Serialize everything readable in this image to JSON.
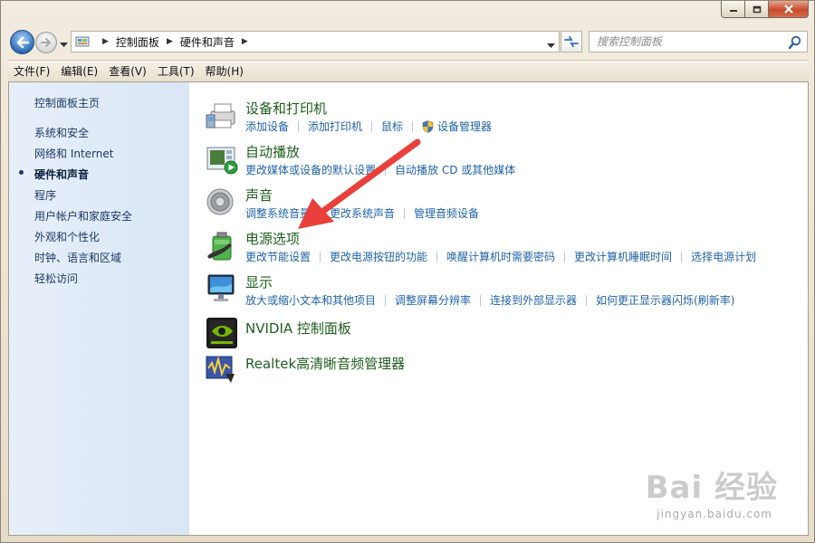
{
  "address": {
    "crumbs": [
      "控制面板",
      "硬件和声音"
    ]
  },
  "search": {
    "placeholder": "搜索控制面板"
  },
  "menu": [
    "文件(F)",
    "编辑(E)",
    "查看(V)",
    "工具(T)",
    "帮助(H)"
  ],
  "sidebar": {
    "home": "控制面板主页",
    "items": [
      {
        "label": "系统和安全",
        "current": false
      },
      {
        "label": "网络和 Internet",
        "current": false
      },
      {
        "label": "硬件和声音",
        "current": true
      },
      {
        "label": "程序",
        "current": false
      },
      {
        "label": "用户帐户和家庭安全",
        "current": false
      },
      {
        "label": "外观和个性化",
        "current": false
      },
      {
        "label": "时钟、语言和区域",
        "current": false
      },
      {
        "label": "轻松访问",
        "current": false
      }
    ]
  },
  "categories": [
    {
      "title": "设备和打印机",
      "icon": "printer-icon",
      "links": [
        "添加设备",
        "添加打印机",
        "鼠标",
        "设备管理器"
      ]
    },
    {
      "title": "自动播放",
      "icon": "autoplay-icon",
      "links": [
        "更改媒体或设备的默认设置",
        "自动播放 CD 或其他媒体"
      ]
    },
    {
      "title": "声音",
      "icon": "speaker-icon",
      "links": [
        "调整系统音量",
        "更改系统声音",
        "管理音频设备"
      ]
    },
    {
      "title": "电源选项",
      "icon": "battery-icon",
      "links": [
        "更改节能设置",
        "更改电源按钮的功能",
        "唤醒计算机时需要密码",
        "更改计算机睡眠时间",
        "选择电源计划"
      ]
    },
    {
      "title": "显示",
      "icon": "monitor-icon",
      "links": [
        "放大或缩小文本和其他项目",
        "调整屏幕分辨率",
        "连接到外部显示器",
        "如何更正显示器闪烁(刷新率)"
      ]
    },
    {
      "title": "NVIDIA 控制面板",
      "icon": "nvidia-icon",
      "links": []
    },
    {
      "title": "Realtek高清晰音频管理器",
      "icon": "realtek-icon",
      "links": []
    }
  ],
  "watermark": {
    "logo": "Bai 经验",
    "url": "jingyan.baidu.com"
  },
  "colors": {
    "link": "#1f63a8",
    "title": "#1e5e1e",
    "arrow": "#e8403a"
  }
}
